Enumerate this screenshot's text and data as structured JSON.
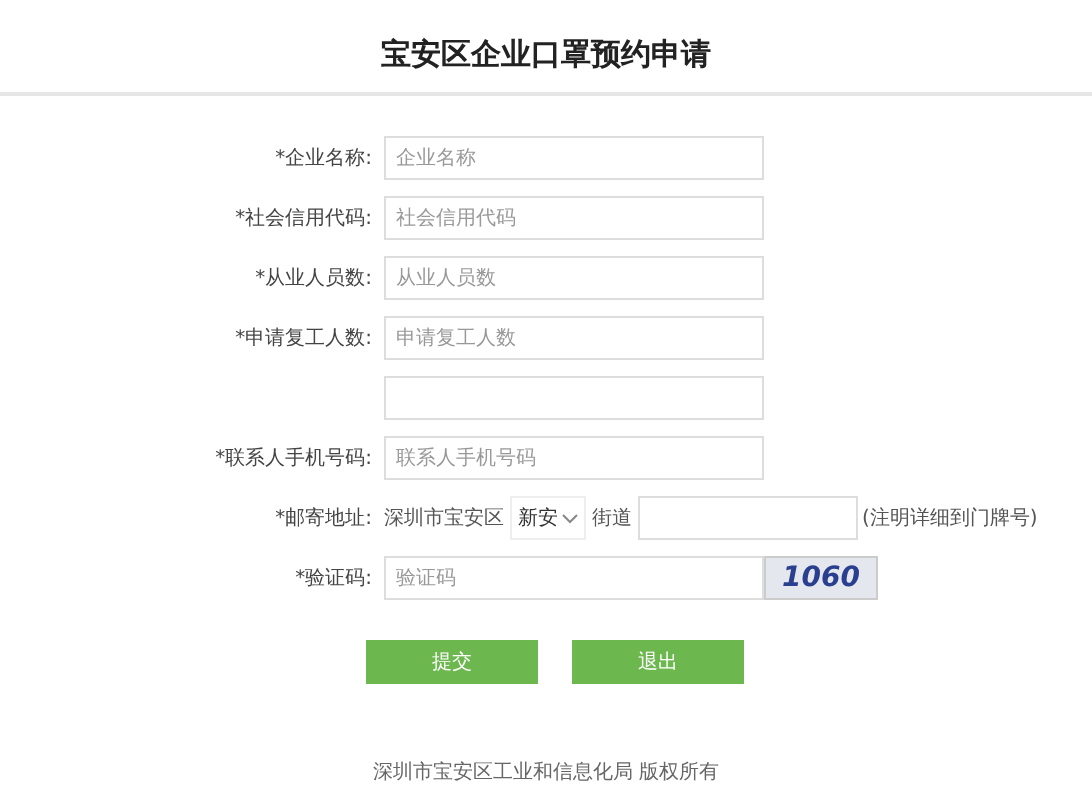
{
  "title": "宝安区企业口罩预约申请",
  "rows": [
    {
      "kind": "text",
      "label": "*企业名称:",
      "placeholder": "企业名称"
    },
    {
      "kind": "text",
      "label": "*社会信用代码:",
      "placeholder": "社会信用代码"
    },
    {
      "kind": "text",
      "label": "*从业人员数:",
      "placeholder": "从业人员数"
    },
    {
      "kind": "text",
      "label": "*申请复工人数:",
      "placeholder": "申请复工人数"
    },
    {
      "kind": "blank"
    },
    {
      "kind": "text",
      "label": "*联系人手机号码:",
      "placeholder": "联系人手机号码"
    },
    {
      "kind": "address",
      "label": "*邮寄地址:",
      "prefix": "深圳市宝安区",
      "street": "新安",
      "suffix": "街道",
      "hint": "(注明详细到门牌号)"
    },
    {
      "kind": "captcha",
      "label": "*验证码:",
      "placeholder": "验证码",
      "code": "1060"
    }
  ],
  "buttons": [
    "提交",
    "退出"
  ],
  "footer": "深圳市宝安区工业和信息化局 版权所有"
}
